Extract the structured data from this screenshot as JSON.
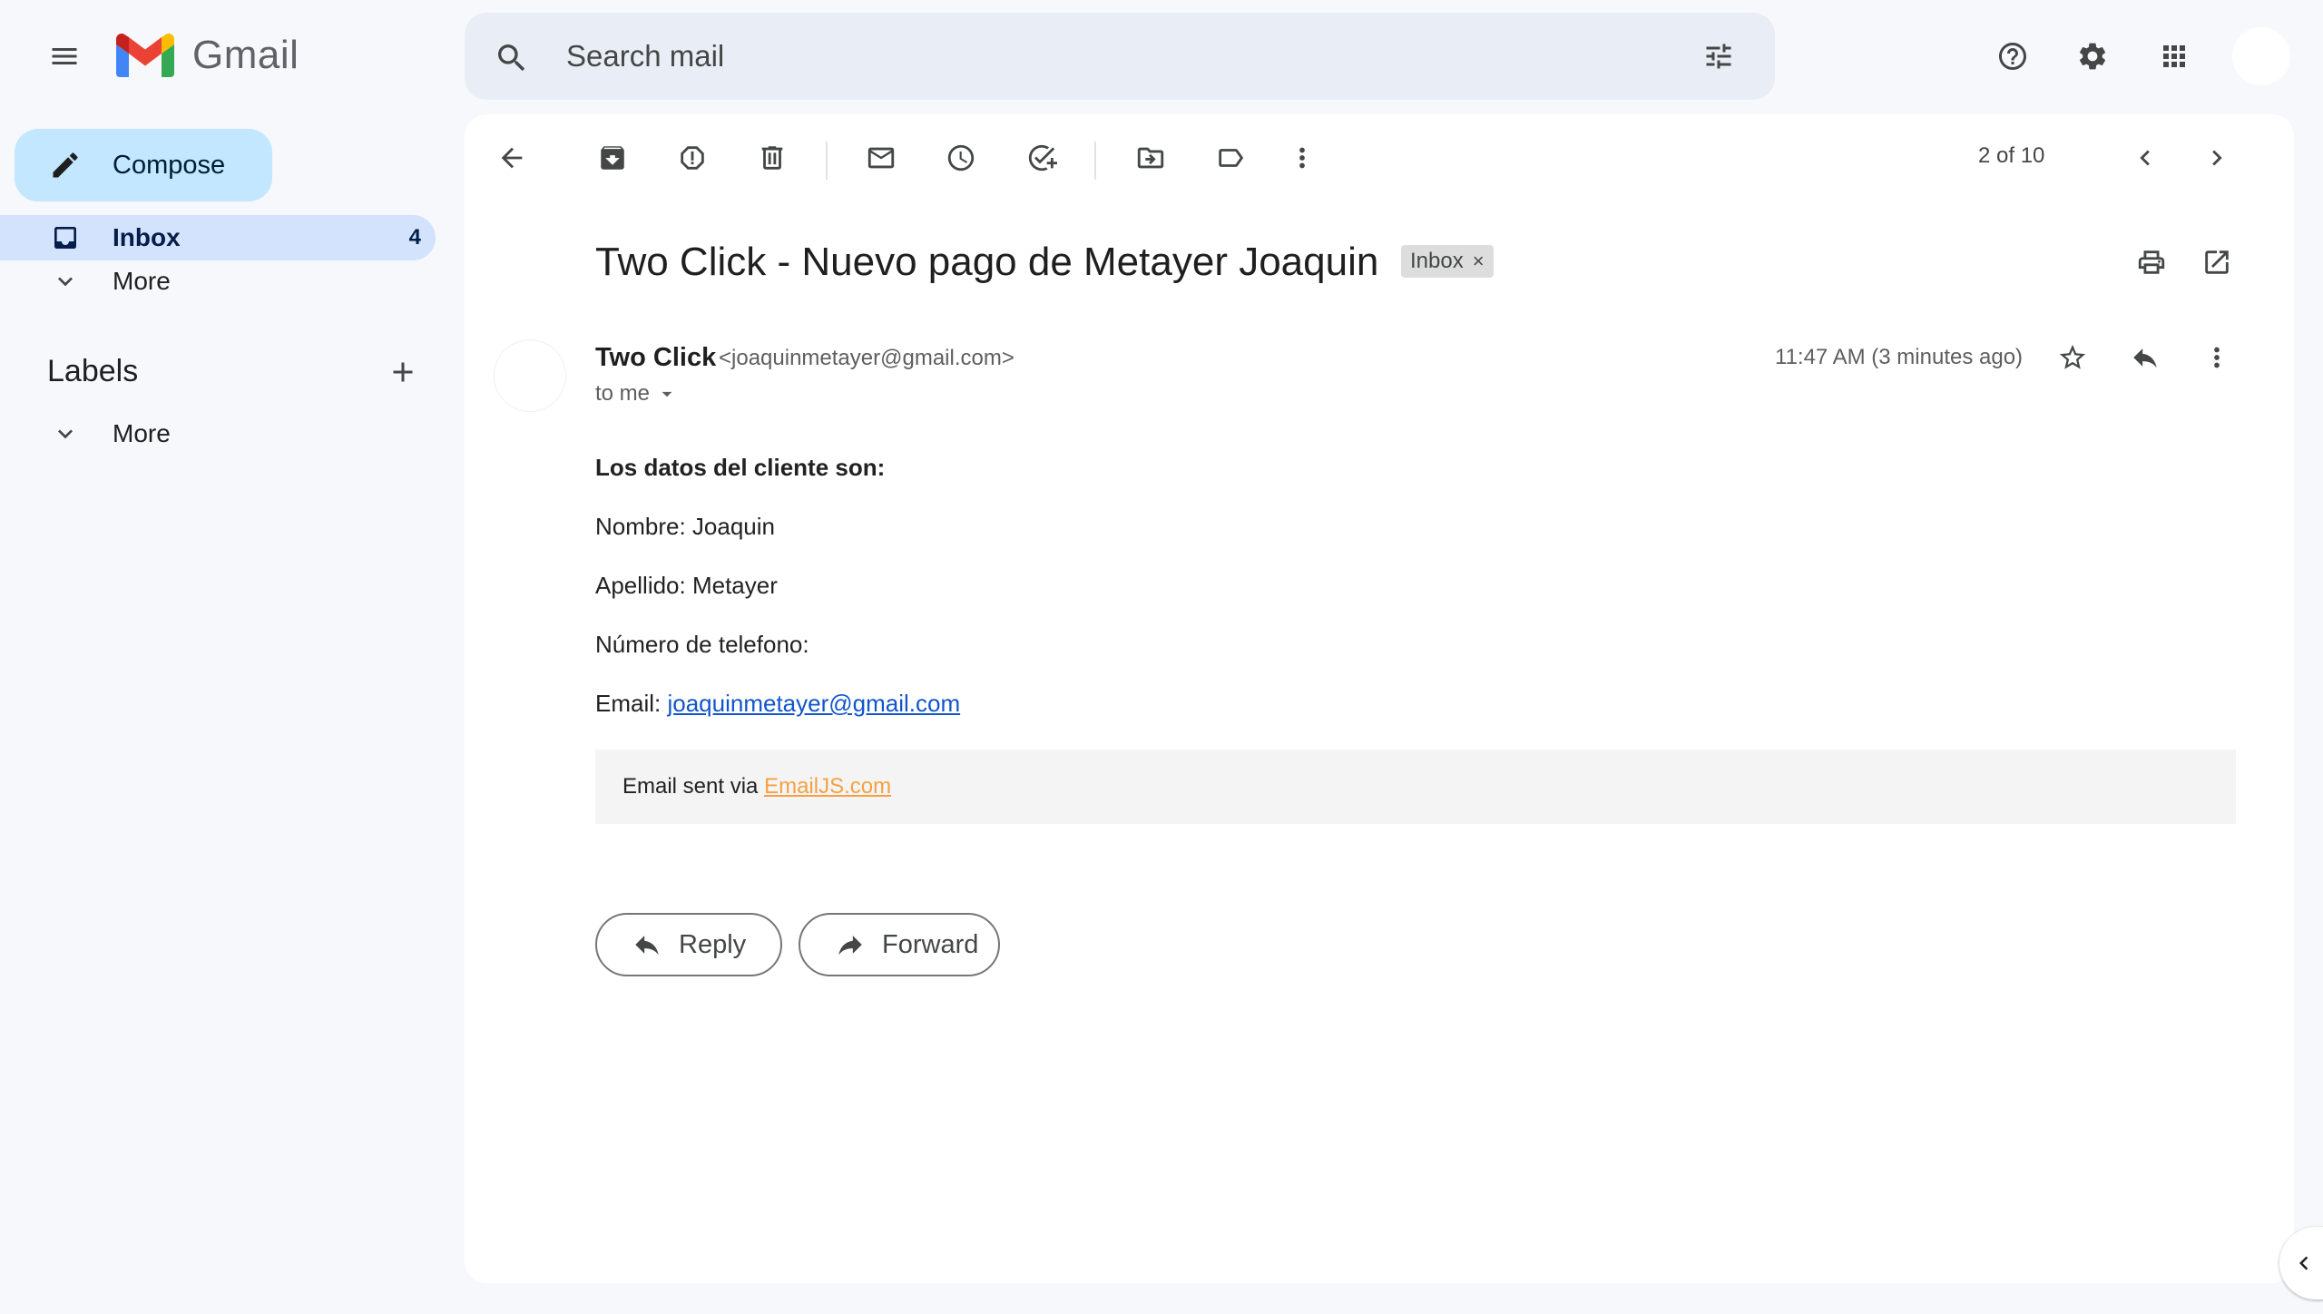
{
  "app": {
    "name": "Gmail"
  },
  "search": {
    "placeholder": "Search mail"
  },
  "sidebar": {
    "compose_label": "Compose",
    "inbox": {
      "label": "Inbox",
      "count": "4"
    },
    "more_label": "More",
    "labels_title": "Labels",
    "labels_more_label": "More"
  },
  "toolbar": {
    "pager": "2 of 10"
  },
  "email": {
    "subject": "Two Click - Nuevo pago de Metayer Joaquin",
    "chip_label": "Inbox",
    "chip_remove": "×",
    "sender_name": "Two Click",
    "sender_email": "<joaquinmetayer@gmail.com>",
    "to_label": "to me",
    "timestamp": "11:47 AM (3 minutes ago)",
    "body": {
      "title": "Los datos del cliente son:",
      "nombre": "Nombre: Joaquin",
      "apellido": "Apellido: Metayer",
      "numero": "Número de telefono:",
      "email_prefix": "Email:",
      "email_link": "joaquinmetayer@gmail.com",
      "footer_prefix": "Email sent via",
      "footer_link": "EmailJS.com"
    }
  },
  "actions": {
    "reply_label": "Reply",
    "forward_label": "Forward"
  },
  "colors": {
    "background": "#f6f8fc",
    "compose": "#c2e7ff",
    "inbox_selected": "#d3e3fd",
    "link": "#1155cc",
    "footer_link": "#f5a142"
  }
}
